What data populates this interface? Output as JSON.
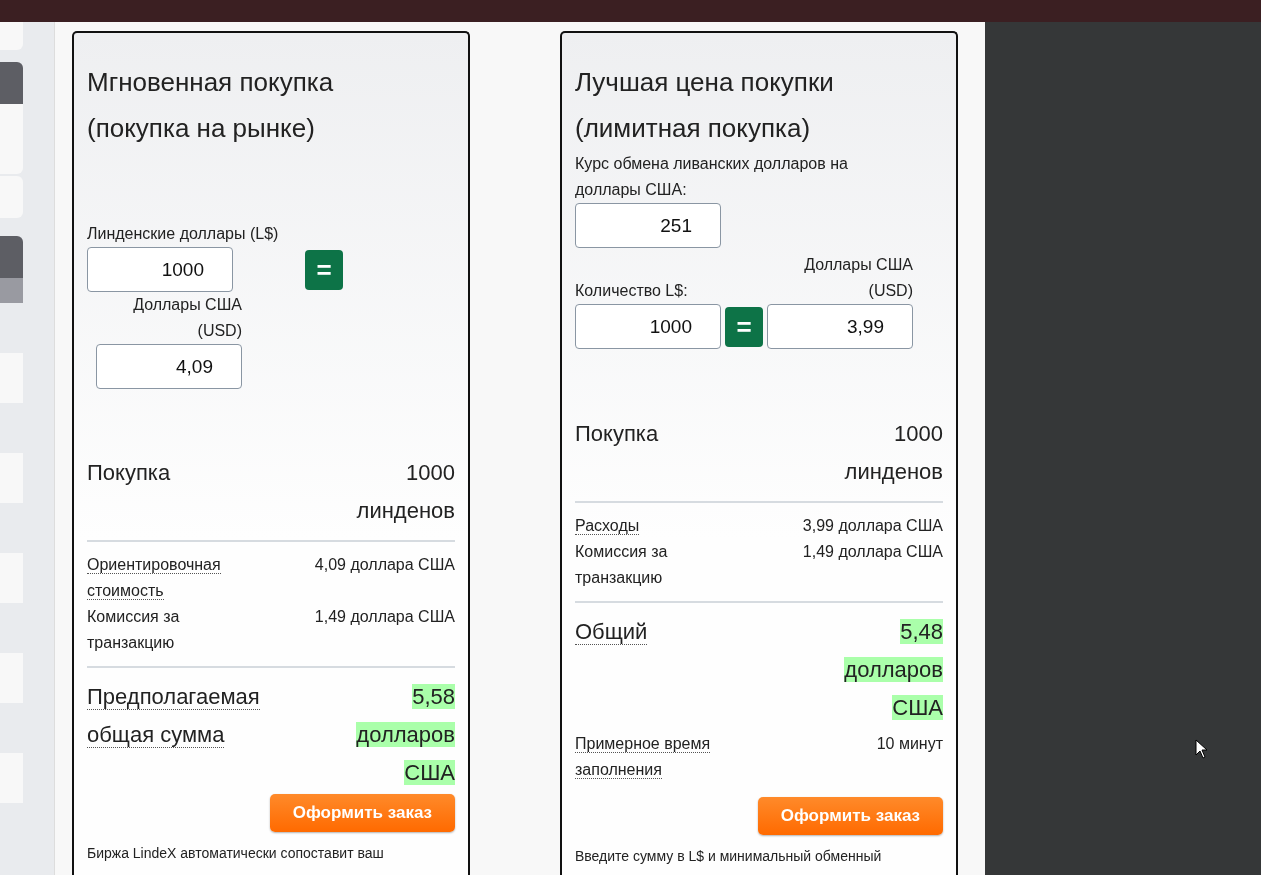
{
  "cards": [
    {
      "kind": "stacked",
      "title": "Мгновенная покупка (покупка на рынке)",
      "amount_label": "Линденские доллары (L$)",
      "amount_value": "1000",
      "equals": "=",
      "usd_label": "Доллары США (USD)",
      "usd_value": "4,09",
      "purchase": {
        "label": "Покупка",
        "value": "1000 линденов"
      },
      "details": [
        {
          "label": "Ориентировочная стоимость",
          "value": "4,09 доллара США",
          "dotted": true
        },
        {
          "label": "Комиссия за транзакцию",
          "value": "1,49 доллара США",
          "dotted": false
        }
      ],
      "total": {
        "label": "Предполагаемая общая сумма",
        "value": "5,58 долларов США"
      },
      "order_button": "Оформить заказ",
      "note": "Биржа LindeX автоматически сопоставит ваш"
    },
    {
      "kind": "inline",
      "title": "Лучшая цена покупки (лимитная покупка)",
      "rate_label": "Курс обмена ливанских долларов на доллары США:",
      "rate_value": "251",
      "amount_label": "Количество L$:",
      "amount_value": "1000",
      "equals": "=",
      "usd_label": "Доллары США (USD)",
      "usd_value": "3,99",
      "purchase": {
        "label": "Покупка",
        "value": "1000 линденов"
      },
      "details": [
        {
          "label": "Расходы",
          "value": "3,99 доллара США",
          "dotted": true
        },
        {
          "label": "Комиссия за транзакцию",
          "value": "1,49 доллара США",
          "dotted": false
        }
      ],
      "total": {
        "label": "Общий",
        "value": "5,48 долларов США"
      },
      "extra": [
        {
          "label": "Примерное время заполнения",
          "value": "10 минут",
          "dotted": true
        }
      ],
      "order_button": "Оформить заказ",
      "note": "Введите сумму в L$ и минимальный обменный"
    }
  ]
}
